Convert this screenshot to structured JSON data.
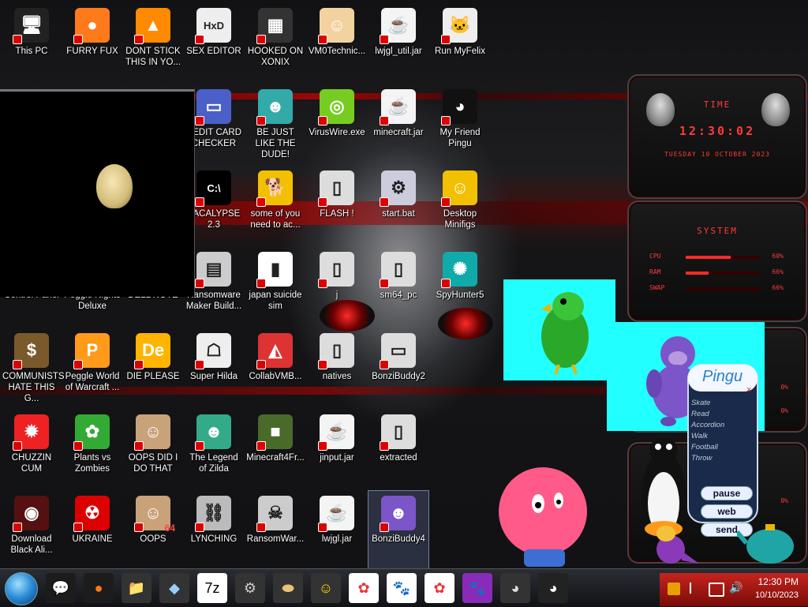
{
  "desktop": {
    "icons": [
      {
        "label": "This PC",
        "icon": "computer-icon"
      },
      {
        "label": "FURRY FUX",
        "icon": "firefox-icon"
      },
      {
        "label": "DONT STICK THIS IN YO...",
        "icon": "vlc-icon"
      },
      {
        "label": "SEX EDITOR",
        "icon": "hex-editor-icon"
      },
      {
        "label": "HOOKED ON XONIX",
        "icon": "game-icon"
      },
      {
        "label": "VM0Technic...",
        "icon": "doctor-icon"
      },
      {
        "label": "lwjgl_util.jar",
        "icon": "java-icon"
      },
      {
        "label": "Run MyFelix",
        "icon": "cat-icon"
      },
      {
        "label": "REDIT CARD CHECKER",
        "icon": "credit-card-icon"
      },
      {
        "label": "BE JUST LIKE THE DUDE!",
        "icon": "elf-icon"
      },
      {
        "label": "VirusWire.exe",
        "icon": "lime-icon"
      },
      {
        "label": "minecraft.jar",
        "icon": "java-icon"
      },
      {
        "label": "My Friend Pingu",
        "icon": "pingu-icon"
      },
      {
        "label": "PACALYPSE 2.3",
        "icon": "terminal-icon"
      },
      {
        "label": "some of you need to ac...",
        "icon": "dog-icon"
      },
      {
        "label": "FLASH !",
        "icon": "folder-icon"
      },
      {
        "label": "start.bat",
        "icon": "batch-file-icon"
      },
      {
        "label": "Desktop Minifigs",
        "icon": "lego-icon"
      },
      {
        "label": "Control Panel",
        "icon": "control-panel-icon"
      },
      {
        "label": "Peggle Nights Deluxe",
        "icon": "peggle-icon"
      },
      {
        "label": "DELL NOTE",
        "icon": "note-icon"
      },
      {
        "label": "Ransomware Maker Build...",
        "icon": "ransomware-icon"
      },
      {
        "label": "japan suicide sim",
        "icon": "document-icon"
      },
      {
        "label": "j",
        "icon": "folder-icon"
      },
      {
        "label": "sm64_pc",
        "icon": "folder-icon"
      },
      {
        "label": "SpyHunter5",
        "icon": "spyhunter-icon"
      },
      {
        "label": "COMMUNISTS HATE THIS G...",
        "icon": "money-bag-icon"
      },
      {
        "label": "Peggle World of Warcraft ...",
        "icon": "peggle-icon"
      },
      {
        "label": "DIE PLEASE",
        "icon": "de-icon"
      },
      {
        "label": "Super Hilda",
        "icon": "pixel-game-icon"
      },
      {
        "label": "CollabVMB...",
        "icon": "collab-icon"
      },
      {
        "label": "natives",
        "icon": "folder-icon"
      },
      {
        "label": "BonziBuddy2",
        "icon": "window-icon"
      },
      {
        "label": "CHUZZIN CUM",
        "icon": "chuzzle-icon"
      },
      {
        "label": "Plants vs Zombies",
        "icon": "plant-icon"
      },
      {
        "label": "OOPS DID I DO THAT",
        "icon": "portrait-icon"
      },
      {
        "label": "The Legend of Zilda",
        "icon": "zelda-icon"
      },
      {
        "label": "Minecraft4Fr...",
        "icon": "grass-block-icon"
      },
      {
        "label": "jinput.jar",
        "icon": "java-icon"
      },
      {
        "label": "extracted",
        "icon": "folder-icon"
      },
      {
        "label": "Download Black Ali...",
        "icon": "alien-icon"
      },
      {
        "label": "UKRAINE",
        "icon": "radiation-icon"
      },
      {
        "label": "OOPS",
        "icon": "portrait-icon"
      },
      {
        "label": "LYNCHING",
        "icon": "gallows-icon"
      },
      {
        "label": "RansomWar...",
        "icon": "skull-icon"
      },
      {
        "label": "lwjgl.jar",
        "icon": "java-icon"
      },
      {
        "label": "BonziBuddy4",
        "icon": "bonzi-icon"
      }
    ],
    "badge_64": "64"
  },
  "gadgets": {
    "clock": {
      "title": "TIME",
      "time": "12:30:02",
      "date": "TUESDAY 10 OCTOBER 2023"
    },
    "system": {
      "title": "SYSTEM",
      "rows": [
        {
          "label": "CPU",
          "pct_text": "60%",
          "value": 0.6
        },
        {
          "label": "RAM",
          "pct_text": "66%",
          "value": 0.3
        },
        {
          "label": "SWAP",
          "pct_text": "66%",
          "value": 0.0
        }
      ]
    },
    "partial_pcts": [
      "0%",
      "0%",
      "0%"
    ]
  },
  "pingu": {
    "title": "Pingu",
    "menu": [
      "Skate",
      "Read",
      "Accordion",
      "Walk",
      "Football",
      "Throw"
    ],
    "buttons": [
      "pause",
      "web",
      "send"
    ]
  },
  "taskbar": {
    "apps": [
      "start-orb",
      "chat-icon",
      "firefox-icon",
      "file-explorer-icon",
      "notes-icon",
      "7zip-icon",
      "setup-icon",
      "bread-icon",
      "homer-icon",
      "hello-kitty-icon",
      "paw-icon",
      "hello-kitty-icon",
      "paw-purple-icon",
      "mouse-icon",
      "pingu-icon"
    ],
    "sevenzip_label": "7z",
    "tray_time": "12:30 PM",
    "tray_date": "10/10/2023"
  },
  "colors": {
    "accent_red": "#ff3a3a",
    "tray_red": "#c4241e",
    "cyan_window": "#22ffff"
  }
}
